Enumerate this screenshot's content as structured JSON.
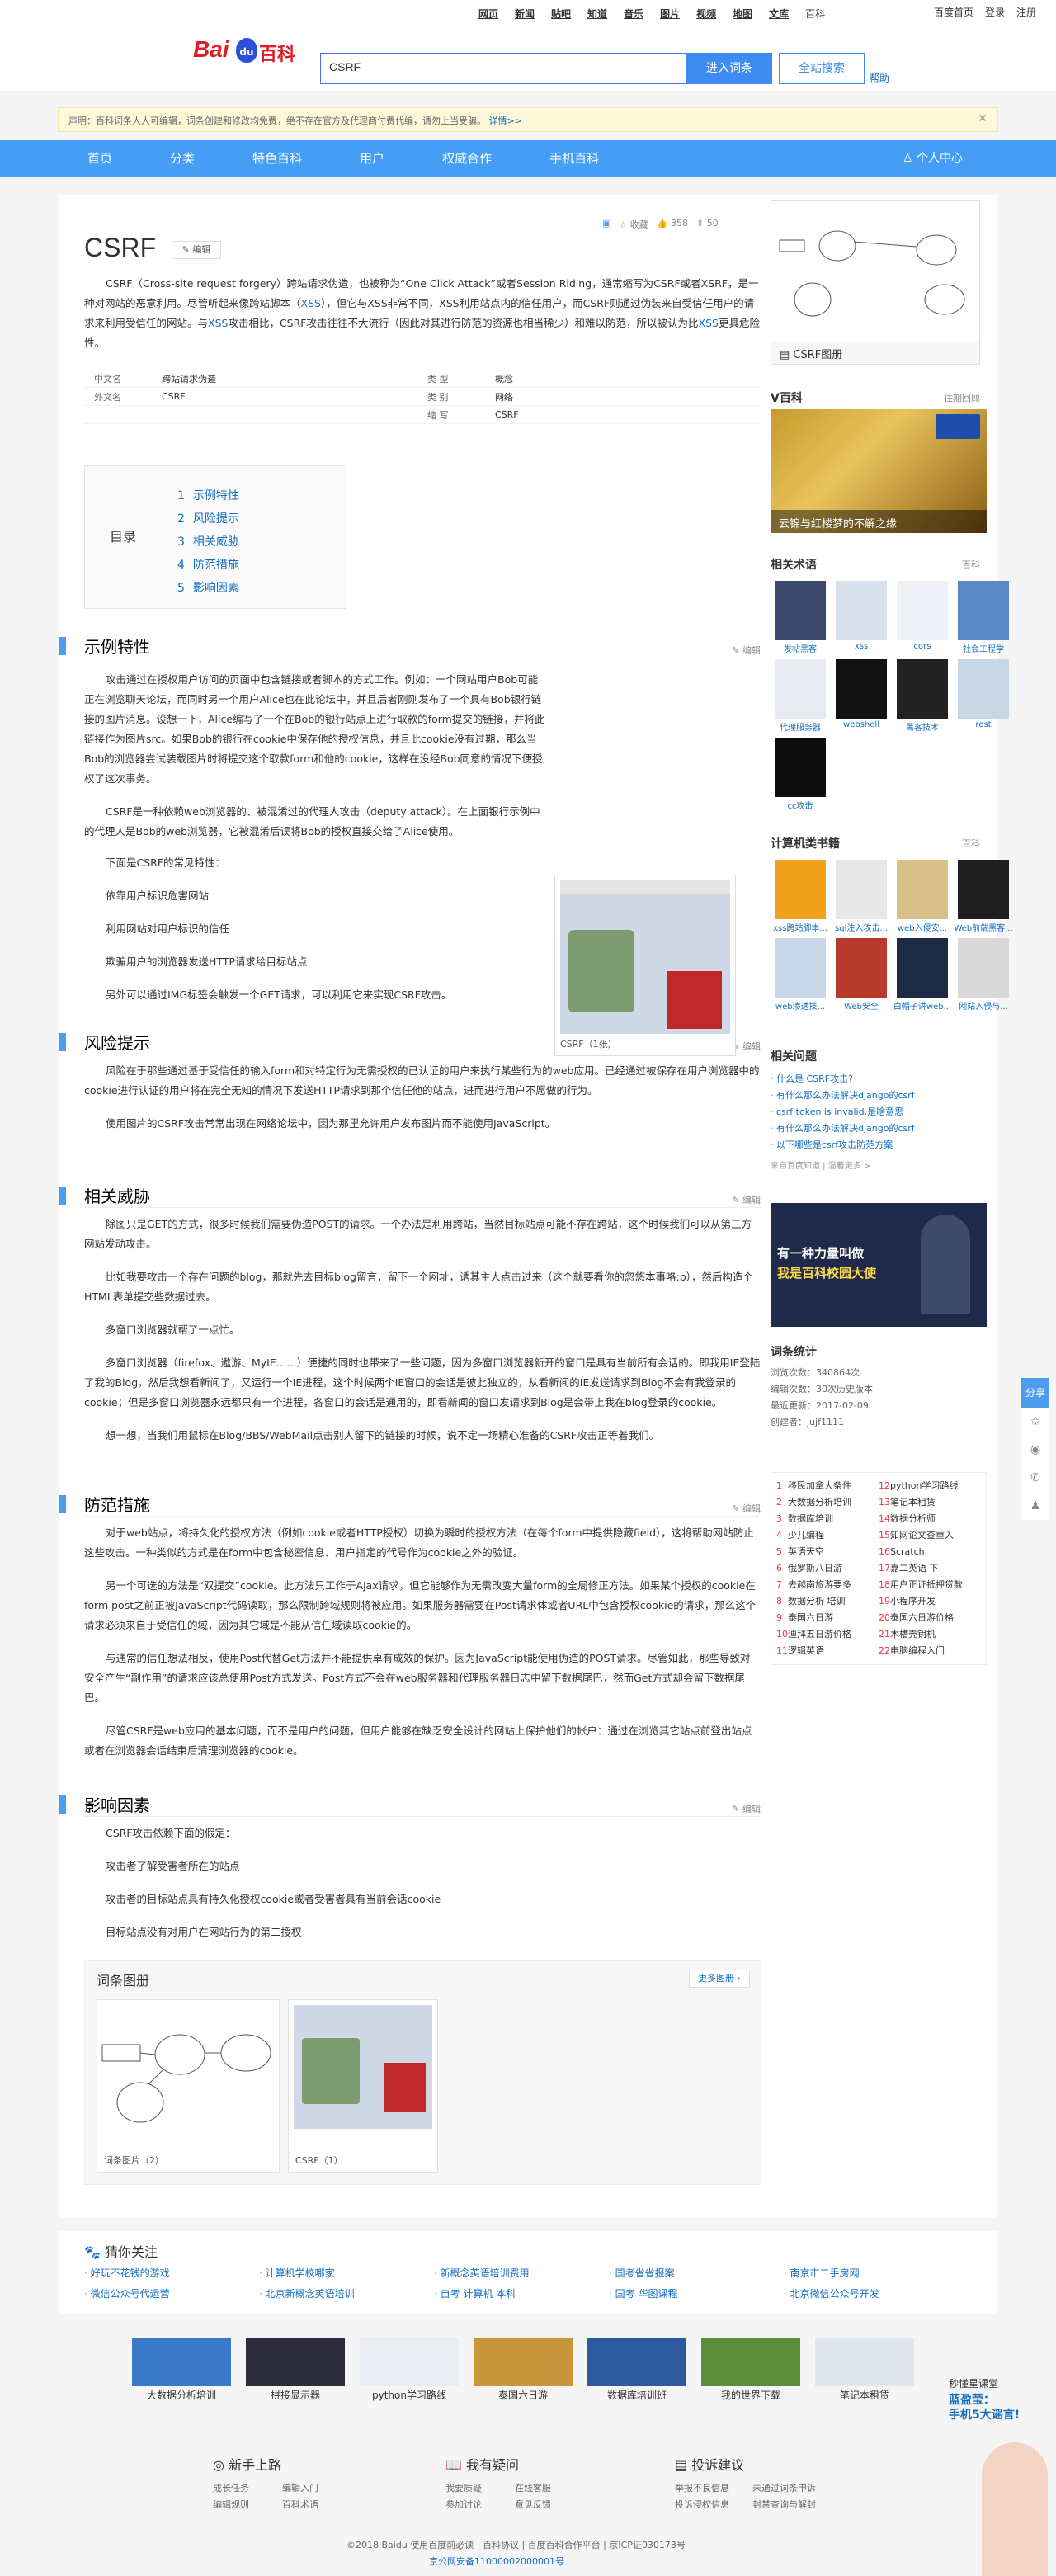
{
  "topnav": {
    "links": [
      "网页",
      "新闻",
      "贴吧",
      "知道",
      "音乐",
      "图片",
      "视频",
      "地图",
      "文库",
      "百科"
    ],
    "right": [
      "百度首页",
      "登录",
      "注册"
    ]
  },
  "header": {
    "logo_bai": "Bai",
    "logo_du": "du",
    "logo_baike": "百科",
    "search_value": "CSRF",
    "enter_btn": "进入词条",
    "all_btn": "全站搜索",
    "help": "帮助"
  },
  "notice": {
    "text": "声明：百科词条人人可编辑，词条创建和修改均免费，绝不存在官方及代理商付费代编，请勿上当受骗。",
    "link": "详情>>",
    "close": "✕"
  },
  "mainnav": {
    "items": [
      "首页",
      "分类",
      "特色百科",
      "用户",
      "权威合作",
      "手机百科"
    ],
    "user_center": "个人中心"
  },
  "entry": {
    "title": "CSRF",
    "edit": "编辑",
    "tools": {
      "collect": "收藏",
      "like_count": "358",
      "share_count": "50"
    },
    "summary_a": "CSRF（Cross-site request forgery）跨站请求伪造，也被称为“One Click Attack”或者Session Riding，通常缩写为CSRF或者XSRF，是一种对网站的恶意利用。尽管听起来像跨站脚本（",
    "summary_link1": "XSS",
    "summary_b": "），但它与XSS非常不同，XSS利用站点内的信任用户，而CSRF则通过伪装来自受信任用户的请求来利用受信任的网站。与",
    "summary_link2": "XSS",
    "summary_c": "攻击相比，CSRF攻击往往不大流行（因此对其进行防范的资源也相当稀少）和难以防范，所以被认为比",
    "summary_link3": "XSS",
    "summary_d": "更具危险性。",
    "basic": [
      {
        "k": "中文名",
        "v": "跨站请求伪造",
        "k2": "类    型",
        "v2": "概念"
      },
      {
        "k": "外文名",
        "v": "CSRF",
        "k2": "类    别",
        "v2": "网络"
      },
      {
        "k": "",
        "v": "",
        "k2": "缩    写",
        "v2": "CSRF"
      }
    ],
    "toc_label": "目录",
    "toc": [
      {
        "n": "1",
        "t": "示例特性"
      },
      {
        "n": "2",
        "t": "风险提示"
      },
      {
        "n": "3",
        "t": "相关威胁"
      },
      {
        "n": "4",
        "t": "防范措施"
      },
      {
        "n": "5",
        "t": "影响因素"
      }
    ],
    "edit_label": "编辑"
  },
  "sections": {
    "s1": {
      "title": "示例特性",
      "p": [
        "攻击通过在授权用户访问的页面中包含链接或者脚本的方式工作。例如：一个网站用户Bob可能正在浏览聊天论坛，而同时另一个用户Alice也在此论坛中，并且后者刚刚发布了一个具有Bob银行链接的图片消息。设想一下，Alice编写了一个在Bob的银行站点上进行取款的form提交的链接，并将此链接作为图片src。如果Bob的银行在cookie中保存他的授权信息，并且此cookie没有过期，那么当Bob的浏览器尝试装载图片时将提交这个取款form和他的cookie，这样在没经Bob同意的情况下便授权了这次事务。",
        "CSRF是一种依赖web浏览器的、被混淆过的代理人攻击（deputy attack）。在上面银行示例中的代理人是Bob的web浏览器，它被混淆后误将Bob的授权直接交给了Alice使用。",
        "下面是CSRF的常见特性：",
        "依靠用户标识危害网站",
        "利用网站对用户标识的信任",
        "欺骗用户的浏览器发送HTTP请求给目标站点",
        "另外可以通过IMG标签会触发一个GET请求，可以利用它来实现CSRF攻击。"
      ],
      "fig_caption": "CSRF（1张）"
    },
    "s2": {
      "title": "风险提示",
      "p": [
        "风险在于那些通过基于受信任的输入form和对特定行为无需授权的已认证的用户来执行某些行为的web应用。已经通过被保存在用户浏览器中的cookie进行认证的用户将在完全无知的情况下发送HTTP请求到那个信任他的站点，进而进行用户不愿做的行为。",
        "使用图片的CSRF攻击常常出现在网络论坛中，因为那里允许用户发布图片而不能使用JavaScript。"
      ]
    },
    "s3": {
      "title": "相关威胁",
      "p": [
        "除图只是GET的方式，很多时候我们需要伪造POST的请求。一个办法是利用跨站，当然目标站点可能不存在跨站，这个时候我们可以从第三方网站发动攻击。",
        "比如我要攻击一个存在问题的blog，那就先去目标blog留言，留下一个网址，诱其主人点击过来（这个就要看你的忽悠本事咯:p），然后构造个HTML表单提交些数据过去。",
        "多窗口浏览器就帮了一点忙。",
        "多窗口浏览器（firefox、遨游、MyIE……）便捷的同时也带来了一些问题，因为多窗口浏览器新开的窗口是具有当前所有会话的。即我用IE登陆了我的Blog，然后我想看新闻了，又运行一个IE进程，这个时候两个IE窗口的会话是彼此独立的，从看新闻的IE发送请求到Blog不会有我登录的cookie；但是多窗口浏览器永远都只有一个进程，各窗口的会话是通用的，即看新闻的窗口发请求到Blog是会带上我在blog登录的cookie。",
        "想一想，当我们用鼠标在Blog/BBS/WebMail点击别人留下的链接的时候，说不定一场精心准备的CSRF攻击正等着我们。"
      ]
    },
    "s4": {
      "title": "防范措施",
      "p": [
        "对于web站点，将持久化的授权方法（例如cookie或者HTTP授权）切换为瞬时的授权方法（在每个form中提供隐藏field），这将帮助网站防止这些攻击。一种类似的方式是在form中包含秘密信息、用户指定的代号作为cookie之外的验证。",
        "另一个可选的方法是“双提交”cookie。此方法只工作于Ajax请求，但它能够作为无需改变大量form的全局修正方法。如果某个授权的cookie在form post之前正被JavaScript代码读取，那么限制跨域规则将被应用。如果服务器需要在Post请求体或者URL中包含授权cookie的请求，那么这个请求必须来自于受信任的域，因为其它域是不能从信任域读取cookie的。",
        "与通常的信任想法相反，使用Post代替Get方法并不能提供卓有成效的保护。因为JavaScript能使用伪造的POST请求。尽管如此，那些导致对安全产生“副作用”的请求应该总使用Post方式发送。Post方式不会在web服务器和代理服务器日志中留下数据尾巴，然而Get方式却会留下数据尾巴。",
        "尽管CSRF是web应用的基本问题，而不是用户的问题，但用户能够在缺乏安全设计的网站上保护他们的帐户：通过在浏览其它站点前登出站点或者在浏览器会话结束后清理浏览器的cookie。"
      ]
    },
    "s5": {
      "title": "影响因素",
      "p": [
        "CSRF攻击依赖下面的假定：",
        "攻击者了解受害者所在的站点",
        "攻击者的目标站点具有持久化授权cookie或者受害者具有当前会话cookie",
        "目标站点没有对用户在网站行为的第二授权"
      ]
    }
  },
  "album": {
    "title": "词条图册",
    "more": "更多图册 ›",
    "cards": [
      "词条图片（2）",
      "CSRF（1）"
    ]
  },
  "side": {
    "album_label": "CSRF图册",
    "vbaike": {
      "title": "V百科",
      "more": "往期回顾",
      "caption": "云锦与红楼梦的不解之缘"
    },
    "related_terms": {
      "title": "相关术语",
      "more": "百科",
      "items": [
        "发帖黑客",
        "xss",
        "cors",
        "社会工程学",
        "代理服务器",
        "webshell",
        "黑客技术",
        "rest",
        "cc攻击"
      ]
    },
    "books": {
      "title": "计算机类书籍",
      "more": "百科",
      "items": [
        "xss跨站脚本...",
        "sql注入攻击...",
        "web入侵安...",
        "Web前端黑客...",
        "web渗透技...",
        "Web安全",
        "白帽子讲web...",
        "网站入侵与..."
      ]
    },
    "questions": {
      "title": "相关问题",
      "items": [
        "什么是 CSRF攻击?",
        "有什么那么办法解决django的csrf",
        "csrf token is invalid.是啥意思",
        "有什么那么办法解决django的csrf",
        "以下哪些是csrf攻击防范方案"
      ],
      "foot": "来自百度知道 | 温着更多 >"
    },
    "banner": {
      "l1": "有一种力量叫做",
      "l2": "我是百科校园大使"
    },
    "stats": {
      "title": "词条统计",
      "items": [
        "浏览次数：340864次",
        "编辑次数：30次历史版本",
        "最近更新：2017-02-09",
        "创建者：jujf1111"
      ]
    },
    "hot": [
      {
        "n": "1",
        "t": "移民加拿大条件"
      },
      {
        "n": "12",
        "t": "python学习路线"
      },
      {
        "n": "2",
        "t": "大数据分析培训"
      },
      {
        "n": "13",
        "t": "笔记本租赁"
      },
      {
        "n": "3",
        "t": "数据库培训"
      },
      {
        "n": "14",
        "t": "数据分析师"
      },
      {
        "n": "4",
        "t": "少儿编程"
      },
      {
        "n": "15",
        "t": "知网论文查重入"
      },
      {
        "n": "5",
        "t": "英语天空"
      },
      {
        "n": "16",
        "t": "Scratch"
      },
      {
        "n": "6",
        "t": "俄罗斯八日游"
      },
      {
        "n": "17",
        "t": "嘉二英语 下"
      },
      {
        "n": "7",
        "t": "去越南旅游要多"
      },
      {
        "n": "18",
        "t": "用户正证抵押贷款"
      },
      {
        "n": "8",
        "t": "数据分析 培训"
      },
      {
        "n": "19",
        "t": "小程序开发"
      },
      {
        "n": "9",
        "t": "泰国六日游"
      },
      {
        "n": "20",
        "t": "泰国六日游价格"
      },
      {
        "n": "10",
        "t": "迪拜五日游价格"
      },
      {
        "n": "21",
        "t": "木槽壳钥机"
      },
      {
        "n": "11",
        "t": "逻辑英语"
      },
      {
        "n": "22",
        "t": "电脑编程入门"
      }
    ]
  },
  "guess": {
    "title": "猜你关注",
    "items": [
      "好玩不花钱的游戏",
      "计算机学校哪家",
      "新概念英语培训费用",
      "国考省省报案",
      "南京市二手房网",
      "微信公众号代运营",
      "北京新概念英语培训",
      "自考 计算机 本科",
      "国考 华图课程",
      "北京微信公众号开发"
    ]
  },
  "ads": [
    "大数据分析培训",
    "拼接显示器",
    "python学习路线",
    "泰国六日游",
    "数据库培训班",
    "我的世界下载",
    "笔记本租赁"
  ],
  "footer": {
    "cols": [
      {
        "h": "新手上路",
        "l": [
          "成长任务",
          "编辑入门",
          "编辑规则",
          "百科术语"
        ]
      },
      {
        "h": "我有疑问",
        "l": [
          "我要质疑",
          "在线客服",
          "参加讨论",
          "意见反馈"
        ]
      },
      {
        "h": "投诉建议",
        "l": [
          "举报不良信息",
          "未通过词条申诉",
          "投诉侵权信息",
          "封禁查询与解封"
        ]
      }
    ],
    "copy": "©2018 Baidu 使用百度前必读 | 百科协议 | 百度百科合作平台 | 京ICP证030173号",
    "beian": "京公网安备11000002000001号"
  },
  "share": {
    "label": "分享"
  },
  "promo": {
    "l1": "秒懂星课堂",
    "l2": "蓝盈莹：",
    "l3": "手机5大谣言!"
  }
}
